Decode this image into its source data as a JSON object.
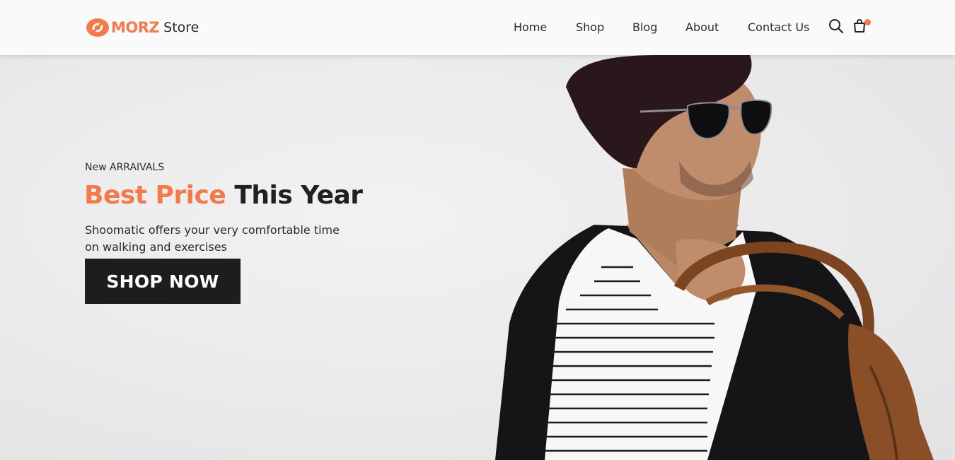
{
  "header": {
    "logo_brand": "MORZ",
    "logo_store": "Store",
    "nav": [
      {
        "label": "Home"
      },
      {
        "label": "Shop"
      },
      {
        "label": "Blog"
      },
      {
        "label": "About"
      },
      {
        "label": "Contact Us"
      }
    ],
    "icons": [
      "search-icon",
      "cart-icon"
    ]
  },
  "hero": {
    "kicker": "New ARRAIVALS",
    "title_accent": "Best Price",
    "title_rest": "This Year",
    "description": "Shoomatic offers your very comfortable time on walking and exercises",
    "cta_label": "SHOP NOW"
  },
  "colors": {
    "accent": "#f27a4b",
    "dark": "#1d1d20",
    "header_bg": "#fafafa",
    "hero_bg": "#ececed"
  }
}
